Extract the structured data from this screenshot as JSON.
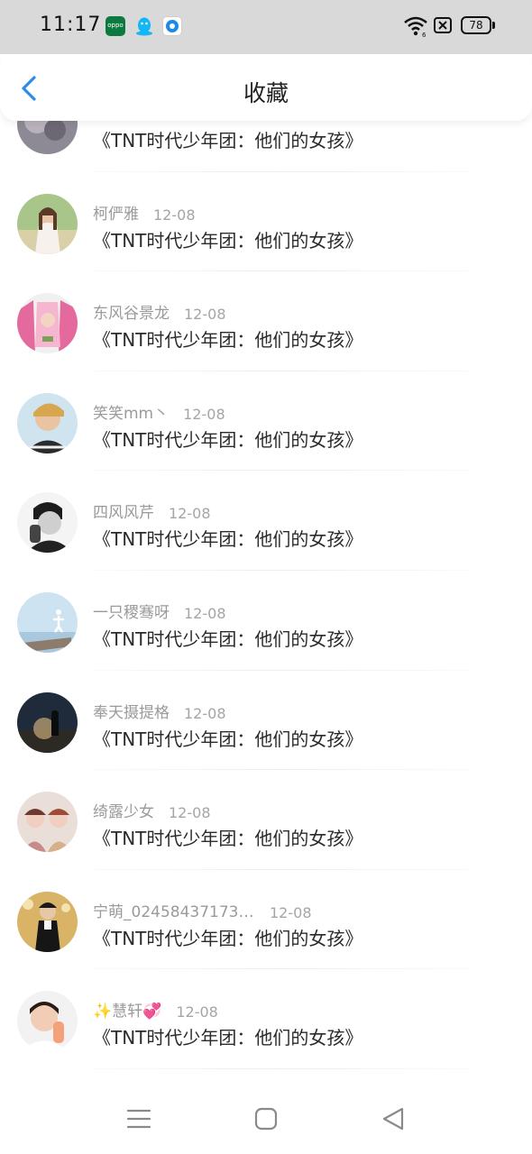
{
  "status_bar": {
    "time": "11:17",
    "oppo_icon_text": "oppo",
    "battery": "78"
  },
  "header": {
    "title": "收藏"
  },
  "colors": {
    "accent": "#2f8be6",
    "status_bar_bg": "#d9d9d9",
    "meta_text": "#9a9a9a",
    "title_text": "#2b2b2b"
  },
  "items": [
    {
      "author": "",
      "date": "",
      "title": "《TNT时代少年团：他们的女孩》"
    },
    {
      "author": "柯俨雅",
      "date": "12-08",
      "title": "《TNT时代少年团：他们的女孩》"
    },
    {
      "author": "东风谷景龙",
      "date": "12-08",
      "title": "《TNT时代少年团：他们的女孩》"
    },
    {
      "author": "笑笑mm丶",
      "date": "12-08",
      "title": "《TNT时代少年团：他们的女孩》"
    },
    {
      "author": "四风风芹",
      "date": "12-08",
      "title": "《TNT时代少年团：他们的女孩》"
    },
    {
      "author": "一只稷骞呀",
      "date": "12-08",
      "title": "《TNT时代少年团：他们的女孩》"
    },
    {
      "author": "奉天摄提格",
      "date": "12-08",
      "title": "《TNT时代少年团：他们的女孩》"
    },
    {
      "author": "绮露少女",
      "date": "12-08",
      "title": "《TNT时代少年团：他们的女孩》"
    },
    {
      "author": "宁萌_024584371732...",
      "date": "12-08",
      "title": "《TNT时代少年团：他们的女孩》"
    },
    {
      "author": "✨慧轩💞",
      "date": "12-08",
      "title": "《TNT时代少年团：他们的女孩》"
    }
  ],
  "icons": {
    "back": "chevron-left-icon",
    "wifi": "wifi-icon",
    "sim": "no-sim-icon",
    "battery": "battery-icon",
    "menu": "menu-icon",
    "home": "home-icon",
    "back_nav": "back-triangle-icon"
  }
}
